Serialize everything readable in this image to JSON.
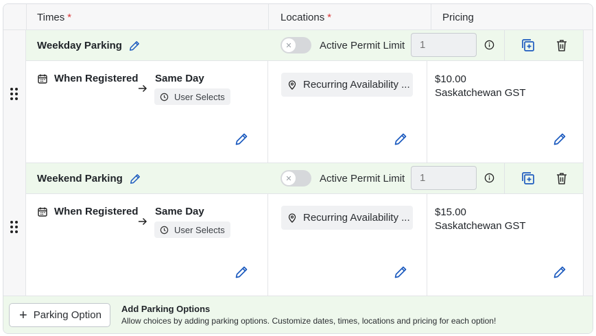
{
  "header": {
    "times_label": "Times",
    "locations_label": "Locations",
    "pricing_label": "Pricing",
    "required_mark": "*"
  },
  "options": [
    {
      "title": "Weekday Parking",
      "permit_toggle": false,
      "permit_label": "Active Permit Limit",
      "permit_limit_placeholder": "1",
      "time_start": "When Registered",
      "time_end": "Same Day",
      "time_chip": "User Selects",
      "location": "Recurring Availability ...",
      "price": "$10.00",
      "tax": "Saskatchewan GST"
    },
    {
      "title": "Weekend Parking",
      "permit_toggle": false,
      "permit_label": "Active Permit Limit",
      "permit_limit_placeholder": "1",
      "time_start": "When Registered",
      "time_end": "Same Day",
      "time_chip": "User Selects",
      "location": "Recurring Availability ...",
      "price": "$15.00",
      "tax": "Saskatchewan GST"
    }
  ],
  "footer": {
    "add_button_label": "Parking Option",
    "title": "Add Parking Options",
    "description": "Allow choices by adding parking options. Customize dates, times, locations and pricing for each option!"
  },
  "colors": {
    "accent_blue": "#1d5bbf",
    "row_header_bg": "#eef8ec",
    "required_red": "#d93a3a"
  }
}
